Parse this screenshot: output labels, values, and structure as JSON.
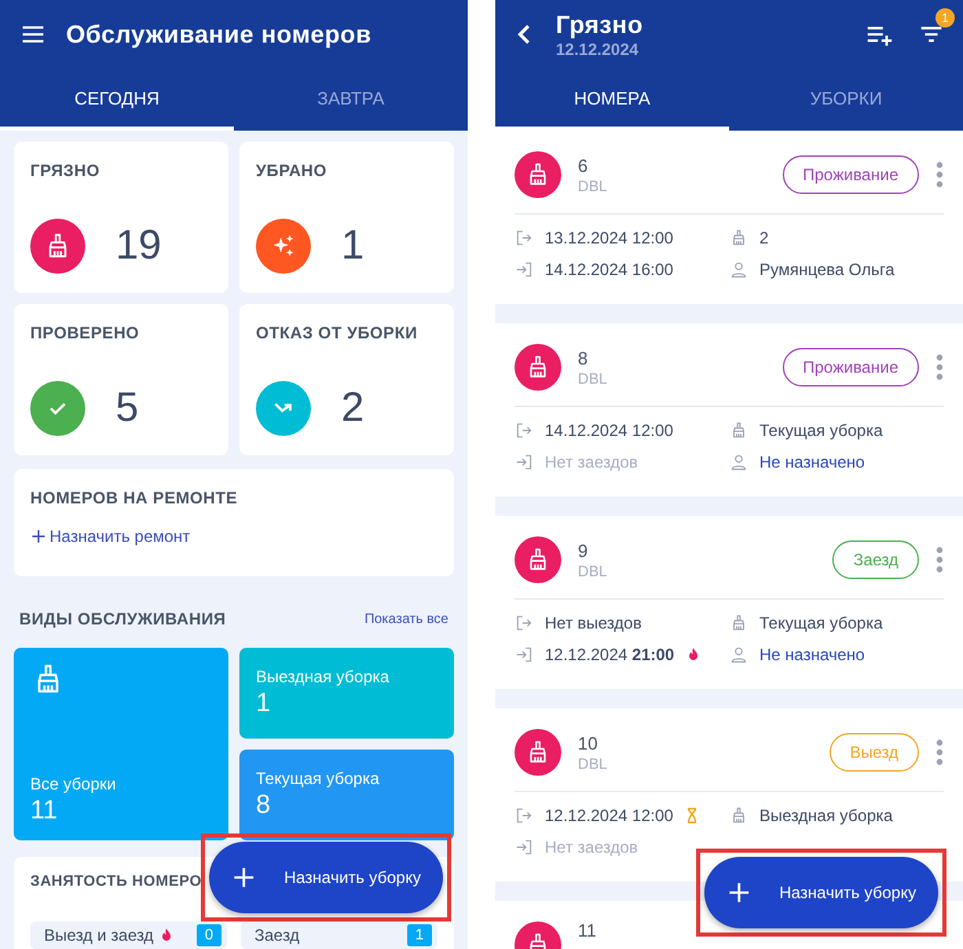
{
  "left": {
    "header": {
      "title": "Обслуживание номеров"
    },
    "tabs": [
      {
        "label": "СЕГОДНЯ",
        "selected": true
      },
      {
        "label": "ЗАВТРА",
        "selected": false
      }
    ],
    "stats": [
      {
        "label": "ГРЯЗНО",
        "value": "19",
        "kind": "dirty"
      },
      {
        "label": "УБРАНО",
        "value": "1",
        "kind": "clean"
      },
      {
        "label": "ПРОВЕРЕНО",
        "value": "5",
        "kind": "checked"
      },
      {
        "label": "ОТКАЗ ОТ УБОРКИ",
        "value": "2",
        "kind": "refused"
      }
    ],
    "repair": {
      "title": "НОМЕРОВ НА РЕМОНТЕ",
      "action": "Назначить ремонт"
    },
    "services": {
      "title": "ВИДЫ ОБСЛУЖИВАНИЯ",
      "link": "Показать все",
      "tiles": [
        {
          "label": "Все уборки",
          "value": "11",
          "kind": "large",
          "color": "#03a9f4"
        },
        {
          "label": "Выездная уборка",
          "value": "1",
          "kind": "small",
          "color": "#00bcd4"
        },
        {
          "label": "Текущая уборка",
          "value": "8",
          "kind": "small",
          "color": "#2196f3"
        }
      ]
    },
    "occupancy": {
      "title": "ЗАНЯТОСТЬ НОМЕРО",
      "items": [
        {
          "label": "Выезд и заезд",
          "count": "0",
          "urgent": true
        },
        {
          "label": "Заезд",
          "count": "1",
          "urgent": false
        }
      ]
    },
    "fab": {
      "label": "Назначить уборку"
    }
  },
  "right": {
    "header": {
      "title": "Грязно",
      "subtitle": "12.12.2024",
      "filter_badge": "1"
    },
    "tabs": [
      {
        "label": "НОМЕРА",
        "selected": true
      },
      {
        "label": "УБОРКИ",
        "selected": false
      }
    ],
    "rooms": [
      {
        "number": "6",
        "type": "DBL",
        "status": "Проживание",
        "color": "#a044b8",
        "checkout": {
          "text": "13.12.2024 12:00",
          "muted": false,
          "waiting": false
        },
        "checkin": {
          "text": "14.12.2024 16:00",
          "muted": false,
          "urgent": false
        },
        "cleaning": "2",
        "assignee": {
          "text": "Румянцева Ольга",
          "unassigned": false
        }
      },
      {
        "number": "8",
        "type": "DBL",
        "status": "Проживание",
        "color": "#a044b8",
        "checkout": {
          "text": "14.12.2024 12:00",
          "muted": false,
          "waiting": false
        },
        "checkin": {
          "text": "Нет заездов",
          "muted": true,
          "urgent": false
        },
        "cleaning": "Текущая уборка",
        "assignee": {
          "text": "Не назначено",
          "unassigned": true
        }
      },
      {
        "number": "9",
        "type": "DBL",
        "status": "Заезд",
        "color": "#4caf50",
        "checkout": {
          "text": "Нет выездов",
          "muted": false,
          "waiting": false
        },
        "checkin": {
          "text": "12.12.2024 **21:00**",
          "muted": false,
          "urgent": true
        },
        "cleaning": "Текущая уборка",
        "assignee": {
          "text": "Не назначено",
          "unassigned": true
        }
      },
      {
        "number": "10",
        "type": "DBL",
        "status": "Выезд",
        "color": "#f5a623",
        "checkout": {
          "text": "12.12.2024 12:00",
          "muted": false,
          "waiting": true
        },
        "checkin": {
          "text": "Нет заездов",
          "muted": true,
          "urgent": false
        },
        "cleaning": "Выездная уборка"
      },
      {
        "number": "11"
      }
    ],
    "fab": {
      "label": "Назначить уборку"
    }
  }
}
